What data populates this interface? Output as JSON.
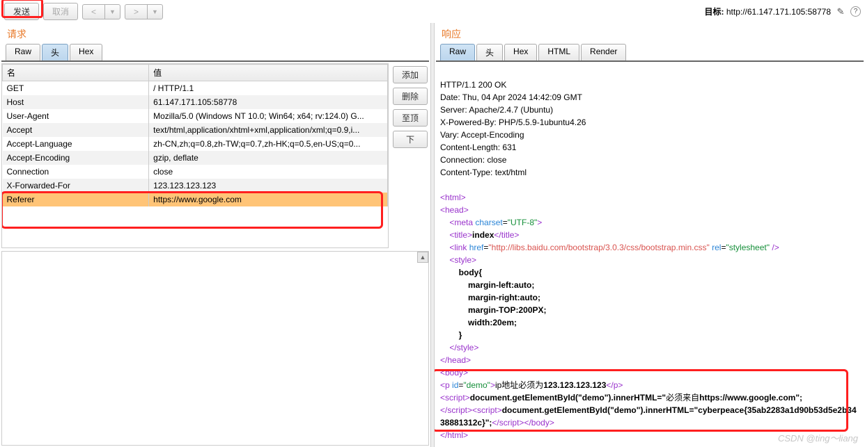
{
  "toolbar": {
    "send": "发送",
    "cancel": "取消",
    "prev": "<",
    "prev_dd": "▼",
    "next": ">",
    "next_dd": "▼",
    "target_label": "目标:",
    "target_url": "http://61.147.171.105:58778"
  },
  "request": {
    "title": "请求",
    "tabs": [
      "Raw",
      "头",
      "Hex"
    ],
    "active_tab": 1,
    "col_name": "名",
    "col_value": "值",
    "rows": [
      {
        "name": "GET",
        "value": "/ HTTP/1.1"
      },
      {
        "name": "Host",
        "value": "61.147.171.105:58778"
      },
      {
        "name": "User-Agent",
        "value": "Mozilla/5.0 (Windows NT 10.0; Win64; x64; rv:124.0) G..."
      },
      {
        "name": "Accept",
        "value": "text/html,application/xhtml+xml,application/xml;q=0.9,i..."
      },
      {
        "name": "Accept-Language",
        "value": "zh-CN,zh;q=0.8,zh-TW;q=0.7,zh-HK;q=0.5,en-US;q=0..."
      },
      {
        "name": "Accept-Encoding",
        "value": "gzip, deflate"
      },
      {
        "name": "Connection",
        "value": "close"
      },
      {
        "name": "X-Forwarded-For",
        "value": "123.123.123.123"
      },
      {
        "name": "Referer",
        "value": "https://www.google.com"
      }
    ],
    "side_buttons": [
      "添加",
      "删除",
      "至顶",
      "下"
    ]
  },
  "response": {
    "title": "响应",
    "tabs": [
      "Raw",
      "头",
      "Hex",
      "HTML",
      "Render"
    ],
    "active_tab": 0,
    "headers_text": "HTTP/1.1 200 OK\nDate: Thu, 04 Apr 2024 14:42:09 GMT\nServer: Apache/2.4.7 (Ubuntu)\nX-Powered-By: PHP/5.5.9-1ubuntu4.26\nVary: Accept-Encoding\nContent-Length: 631\nConnection: close\nContent-Type: text/html",
    "body": {
      "meta_charset": "\"UTF-8\"",
      "title_text": "index",
      "link_href": "\"http://libs.baidu.com/bootstrap/3.0.3/css/bootstrap.min.css\"",
      "link_rel": "\"stylesheet\"",
      "style_lines": [
        "body{",
        "margin-left:auto;",
        "margin-right:auto;",
        "margin-TOP:200PX;",
        "width:20em;",
        "}"
      ],
      "p_id": "\"demo\"",
      "p_text_prefix": "ip地址必须为",
      "p_text_bold": "123.123.123.123",
      "script1_pre": "document.getElementById(\"demo\").innerHTML=\"",
      "script1_mid": "必须来自",
      "script1_bold": "https://www.google.com\";",
      "script2_pre": "document.getElementById(\"demo\").innerHTML=\"",
      "script2_bold": "cyberpeace{35ab2283a1d90b53d5e2b3438881312c}\";"
    }
  },
  "watermark": "CSDN @ting～liang"
}
